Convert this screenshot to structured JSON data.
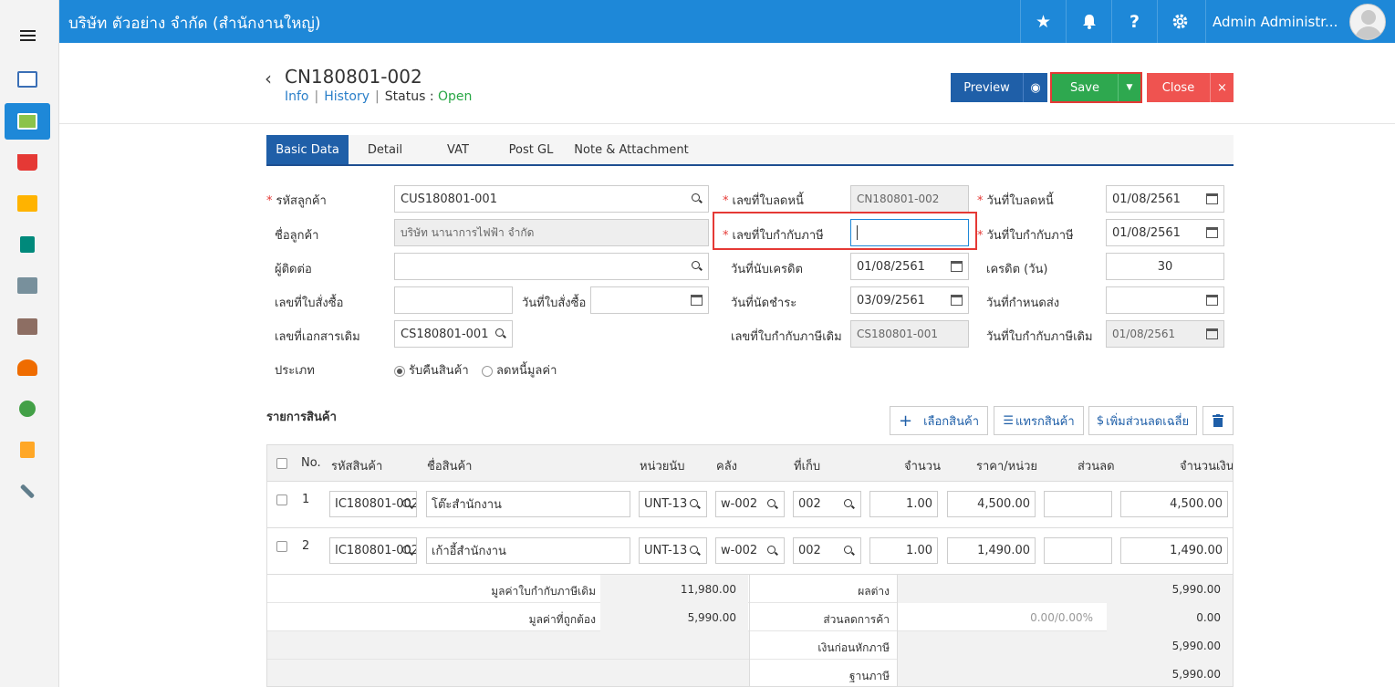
{
  "app": {
    "company": "บริษัท ตัวอย่าง จำกัด (สำนักงานใหญ่)",
    "user": "Admin Administr..."
  },
  "doc": {
    "title": "CN180801-002",
    "info": "Info",
    "history": "History",
    "status_label": "Status",
    "status_value": "Open"
  },
  "actions": {
    "preview": "Preview",
    "save": "Save",
    "close": "Close"
  },
  "tabs": [
    "Basic Data",
    "Detail",
    "VAT",
    "Post GL",
    "Note & Attachment"
  ],
  "form": {
    "customer_code_label": "รหัสลูกค้า",
    "customer_code": "CUS180801-001",
    "customer_name_label": "ชื่อลูกค้า",
    "customer_name": "บริษัท นานาการไฟฟ้า จำกัด",
    "contact_label": "ผู้ติดต่อ",
    "contact": "",
    "po_no_label": "เลขที่ใบสั่งซื้อ",
    "po_no": "",
    "po_date_label": "วันที่ใบสั่งซื้อ",
    "po_date": "",
    "ref_doc_label": "เลขที่เอกสารเดิม",
    "ref_doc": "CS180801-001",
    "type_label": "ประเภท",
    "type_opt1": "รับคืนสินค้า",
    "type_opt2": "ลดหนี้มูลค่า",
    "cn_no_label": "เลขที่ใบลดหนี้",
    "cn_no": "CN180801-002",
    "tax_inv_label": "เลขที่ใบกำกับภาษี",
    "tax_inv": "",
    "credit_start_label": "วันที่นับเครดิต",
    "credit_start": "01/08/2561",
    "due_date_label": "วันที่นัดชำระ",
    "due_date": "03/09/2561",
    "orig_tax_inv_label": "เลขที่ใบกำกับภาษีเดิม",
    "orig_tax_inv": "CS180801-001",
    "cn_date_label": "วันที่ใบลดหนี้",
    "cn_date": "01/08/2561",
    "tax_inv_date_label": "วันที่ใบกำกับภาษี",
    "tax_inv_date": "01/08/2561",
    "credit_days_label": "เครดิต (วัน)",
    "credit_days": "30",
    "delivery_date_label": "วันที่กำหนดส่ง",
    "delivery_date": "",
    "orig_tax_inv_date_label": "วันที่ใบกำกับภาษีเดิม",
    "orig_tax_inv_date": "01/08/2561"
  },
  "items": {
    "title": "รายการสินค้า",
    "select_btn": "เลือกสินค้า",
    "insert_btn": "แทรกสินค้า",
    "discount_btn": "เพิ่มส่วนลดเฉลี่ย",
    "columns": {
      "no": "No.",
      "code": "รหัสสินค้า",
      "name": "ชื่อสินค้า",
      "unit": "หน่วยนับ",
      "warehouse": "คลัง",
      "location": "ที่เก็บ",
      "qty": "จำนวน",
      "price": "ราคา/หน่วย",
      "discount": "ส่วนลด",
      "amount": "จำนวนเงิน"
    },
    "rows": [
      {
        "no": "1",
        "code": "IC180801-002",
        "name": "โต๊ะสำนักงาน",
        "unit": "UNT-13",
        "warehouse": "w-002",
        "location": "002",
        "qty": "1.00",
        "price": "4,500.00",
        "discount": "",
        "amount": "4,500.00"
      },
      {
        "no": "2",
        "code": "IC180801-002",
        "name": "เก้าอี้สำนักงาน",
        "unit": "UNT-13",
        "warehouse": "w-002",
        "location": "002",
        "qty": "1.00",
        "price": "1,490.00",
        "discount": "",
        "amount": "1,490.00"
      }
    ]
  },
  "summary": {
    "orig_value_label": "มูลค่าใบกำกับภาษีเดิม",
    "orig_value": "11,980.00",
    "correct_value_label": "มูลค่าที่ถูกต้อง",
    "correct_value": "5,990.00",
    "diff_label": "ผลต่าง",
    "diff": "5,990.00",
    "trade_discount_label": "ส่วนลดการค้า",
    "trade_discount_pct": "0.00/0.00%",
    "trade_discount": "0.00",
    "before_tax_label": "เงินก่อนหักภาษี",
    "before_tax": "5,990.00",
    "tax_base_label": "ฐานภาษี",
    "tax_base": "5,990.00"
  }
}
